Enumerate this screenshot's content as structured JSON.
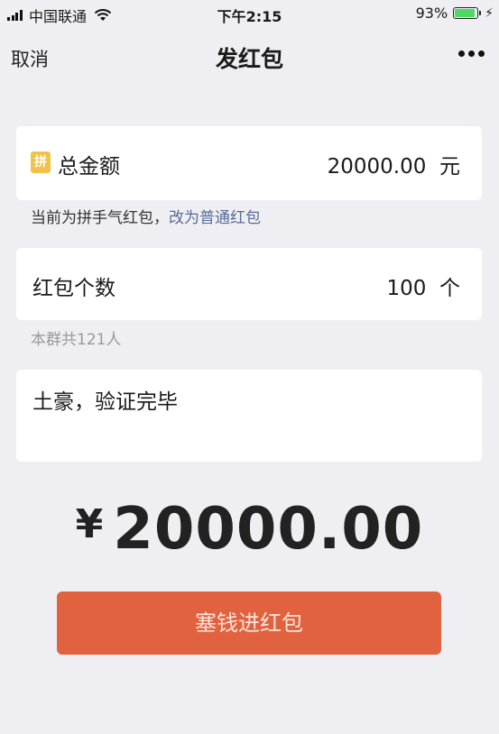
{
  "status_bar": {
    "carrier": "中国联通",
    "time": "下午2:15",
    "battery_percent": "93%",
    "battery_level": 0.93
  },
  "nav": {
    "cancel": "取消",
    "title": "发红包"
  },
  "amount": {
    "icon_text": "拼",
    "label": "总金额",
    "value": "20000.00",
    "unit": "元"
  },
  "type_hint": {
    "text": "当前为拼手气红包，",
    "link": "改为普通红包"
  },
  "count": {
    "label": "红包个数",
    "value": "100",
    "unit": "个"
  },
  "group_hint": "本群共121人",
  "message": "土豪，验证完毕",
  "total": {
    "currency": "¥",
    "value": "20000.00"
  },
  "submit_label": "塞钱进红包",
  "colors": {
    "background": "#efeff3",
    "button": "#e0623f",
    "link": "#576b95",
    "pin_icon": "#f1c24a"
  }
}
